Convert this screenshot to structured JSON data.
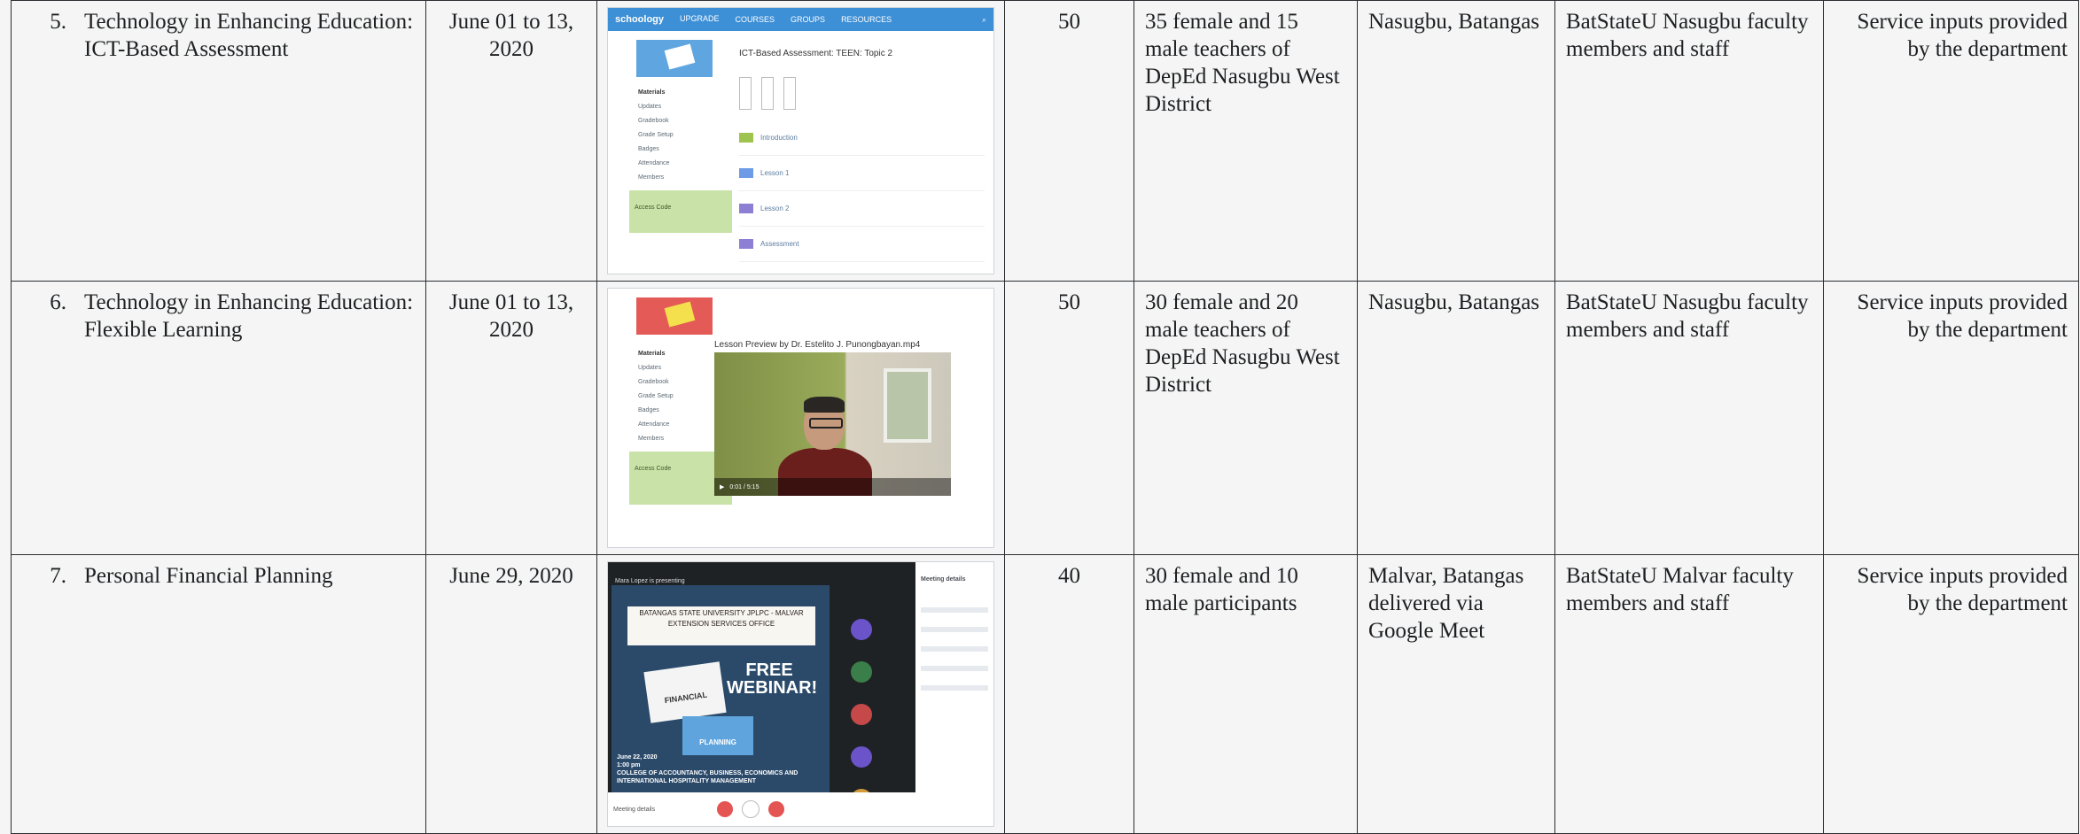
{
  "rows": [
    {
      "number": "5.",
      "title": "Technology in Enhancing Education: ICT-Based Assessment",
      "date": "June 01 to 13, 2020",
      "participants_count": "50",
      "participants_detail": "35 female and 15 male teachers of DepEd Nasugbu West District",
      "venue": "Nasugbu, Batangas",
      "implementers": "BatStateU  Nasugbu faculty members and staff",
      "remarks": "Service inputs provided by the department",
      "screenshot": {
        "app_name": "schoology",
        "nav": [
          "UPGRADE",
          "COURSES",
          "GROUPS",
          "RESOURCES"
        ],
        "heading": "ICT-Based Assessment: TEEN: Topic 2",
        "sidebar": [
          "Materials",
          "Updates",
          "Gradebook",
          "Grade Setup",
          "Badges",
          "Attendance",
          "Members"
        ],
        "access_code_label": "Access Code",
        "folders": [
          "Introduction",
          "Lesson 1",
          "Lesson 2",
          "Assessment"
        ]
      }
    },
    {
      "number": "6.",
      "title": "Technology in Enhancing Education: Flexible Learning",
      "date": "June 01 to 13, 2020",
      "participants_count": "50",
      "participants_detail": "30 female and 20 male teachers of DepEd Nasugbu West District",
      "venue": "Nasugbu, Batangas",
      "implementers": "BatStateU  Nasugbu faculty members and staff",
      "remarks": "Service inputs provided by the department",
      "screenshot": {
        "video_title": "Lesson Preview by Dr. Estelito J. Punongbayan.mp4",
        "video_time": "0:01 / 5:15",
        "sidebar": [
          "Materials",
          "Updates",
          "Gradebook",
          "Grade Setup",
          "Badges",
          "Attendance",
          "Members"
        ],
        "access_code_label": "Access Code"
      }
    },
    {
      "number": "7.",
      "title": "Personal Financial Planning",
      "date": "June 29, 2020",
      "participants_count": "40",
      "participants_detail": "30 female and 10 male participants",
      "venue": "Malvar, Batangas delivered via Google Meet",
      "implementers": "BatStateU Malvar faculty members and staff",
      "remarks": "Service inputs provided by the department",
      "screenshot": {
        "presenting_label": "Mara Lopez is presenting",
        "poster_line1": "BATANGAS STATE UNIVERSITY JPLPC - MALVAR",
        "poster_line2": "EXTENSION SERVICES OFFICE",
        "poster_financial": "FINANCIAL",
        "poster_free": "FREE",
        "poster_webinar": "WEBINAR!",
        "poster_planning": "PLANNING",
        "poster_date": "June 22, 2020",
        "poster_time": "1:00 pm",
        "poster_footer": "COLLEGE OF ACCOUNTANCY, BUSINESS, ECONOMICS AND INTERNATIONAL HOSPITALITY MANAGEMENT",
        "meeting_details": "Meeting details",
        "participants_panel_title": "Meeting details",
        "colors": {
          "red": "#e35453",
          "poster_bg": "#2b4a6a"
        }
      }
    }
  ]
}
